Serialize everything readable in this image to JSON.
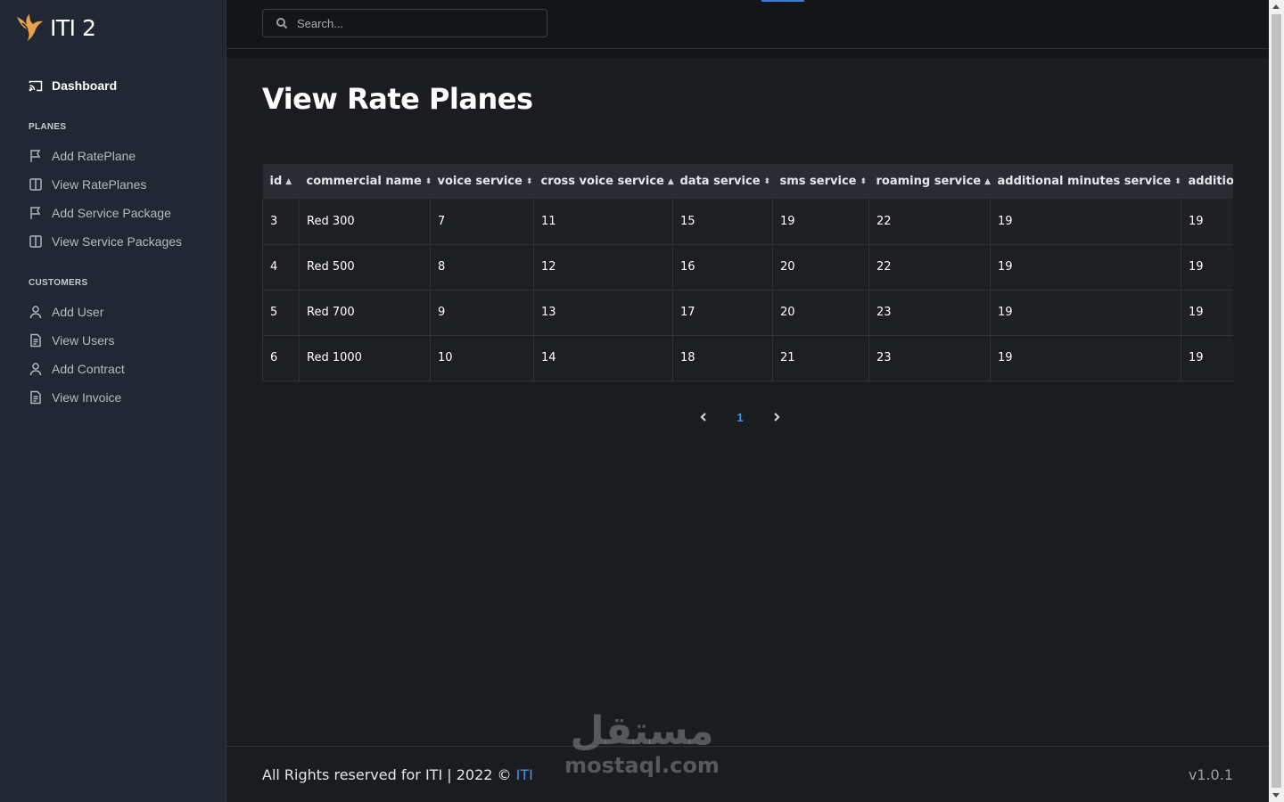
{
  "brand": {
    "name": "ITI 2"
  },
  "sidebar": {
    "dashboard": "Dashboard",
    "sections": [
      {
        "title": "PLANES",
        "items": [
          "Add RatePlane",
          "View RatePlanes",
          "Add Service Package",
          "View Service Packages"
        ]
      },
      {
        "title": "CUSTOMERS",
        "items": [
          "Add User",
          "View Users",
          "Add Contract",
          "View Invoice"
        ]
      }
    ]
  },
  "search": {
    "placeholder": "Search..."
  },
  "page": {
    "title": "View Rate Planes"
  },
  "table": {
    "columns": [
      "id",
      "commercial name",
      "voice service",
      "cross voice service",
      "data service",
      "sms service",
      "roaming service",
      "additional minutes service",
      "additio"
    ],
    "sort_icons": [
      "▲",
      "⬍",
      "⬍",
      "▲",
      "⬍",
      "⬍",
      "▲",
      "⬍",
      ""
    ],
    "rows": [
      [
        "3",
        "Red 300",
        "7",
        "11",
        "15",
        "19",
        "22",
        "19",
        "19"
      ],
      [
        "4",
        "Red 500",
        "8",
        "12",
        "16",
        "20",
        "22",
        "19",
        "19"
      ],
      [
        "5",
        "Red 700",
        "9",
        "13",
        "17",
        "20",
        "23",
        "19",
        "19"
      ],
      [
        "6",
        "Red 1000",
        "10",
        "14",
        "18",
        "21",
        "23",
        "19",
        "19"
      ]
    ]
  },
  "pagination": {
    "current": "1"
  },
  "footer": {
    "text": "All Rights reserved for ITI | 2022 ©",
    "link": "ITI",
    "version": "v1.0.1"
  },
  "watermark": {
    "arabic": "مستقل",
    "latin": "mostaql.com"
  },
  "colors": {
    "sidebar_bg": "#212733",
    "main_bg": "#1a1c1f",
    "accent": "#4a90e2",
    "logo": "#e7a24b"
  }
}
